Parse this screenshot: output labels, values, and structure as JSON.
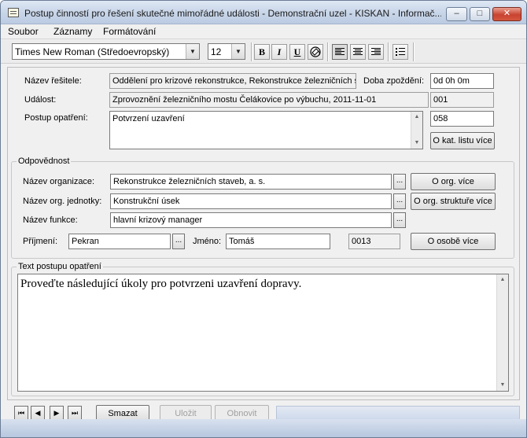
{
  "window": {
    "title": "Postup činností pro řešení skutečné mimořádné události - Demonstrační uzel - KISKAN - Informač...",
    "minimize_glyph": "–",
    "maximize_glyph": "□",
    "close_glyph": "✕"
  },
  "menu": {
    "items": [
      "Soubor",
      "Záznamy",
      "Formátování"
    ]
  },
  "toolbar": {
    "font_name": "Times New Roman (Středoevropský)",
    "font_size": "12",
    "bold_label": "B",
    "italic_label": "I",
    "underline_label": "U",
    "color_icon": "paint-icon",
    "align_left_icon": "align-left-icon",
    "align_center_icon": "align-center-icon",
    "align_right_icon": "align-right-icon",
    "bullet_list_icon": "bullet-list-icon"
  },
  "form": {
    "resitel_label": "Název řešitele:",
    "resitel_value": "Oddělení pro krizové rekonstrukce, Rekonstrukce železničních st",
    "delay_label": "Doba zpoždění:",
    "delay_value": "0d 0h 0m",
    "udalost_label": "Událost:",
    "udalost_value": "Zprovoznění železničního mostu Čelákovice po výbuchu, 2011-11-01",
    "udalost_code": "001",
    "postup_label": "Postup opatření:",
    "postup_value": "Potvrzení uzavření",
    "postup_code": "058",
    "catalog_button": "O kat. listu více"
  },
  "responsibility": {
    "title": "Odpovědnost",
    "org_label": "Název organizace:",
    "org_value": "Rekonstrukce železničních staveb, a. s.",
    "org_button": "O org. více",
    "unit_label": "Název org. jednotky:",
    "unit_value": "Konstrukční úsek",
    "unit_button": "O org. struktuře více",
    "func_label": "Název funkce:",
    "func_value": "hlavní krizový manager",
    "surname_label": "Příjmení:",
    "surname_value": "Pekran",
    "name_label": "Jméno:",
    "name_value": "Tomáš",
    "person_code": "0013",
    "person_button": "O osobě více",
    "ellipsis": "..."
  },
  "text_group": {
    "title": "Text postupu opatření",
    "body": "Proveďte následující úkoly pro potvrzeni uzavření dopravy."
  },
  "bottom": {
    "first": "⏮",
    "prev": "◀",
    "next": "▶",
    "last": "⏭",
    "delete_button": "Smazat",
    "save_button": "Uložit",
    "restore_button": "Obnovit"
  },
  "colors": {
    "title_bar": "#c7d5e8",
    "window_bg": "#f0f0f0",
    "close_button": "#c94331"
  }
}
